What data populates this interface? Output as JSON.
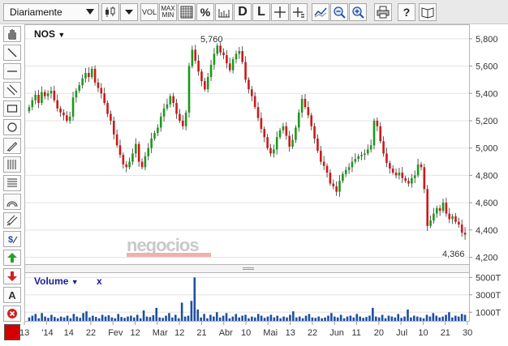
{
  "toolbar": {
    "period_label": "Diariamente",
    "vol_label": "VOL",
    "maxmin_top": "MAX",
    "maxmin_bottom": "MIN",
    "percent_label": "%",
    "daily_label": "D",
    "line_label": "L",
    "icons": [
      "candle-type-icon",
      "chart-style-icon",
      "grid-icon",
      "scale-icon",
      "crosshair-icon",
      "crosshair-value-icon",
      "compare-icon",
      "zoom-out-icon",
      "zoom-in-icon",
      "print-icon",
      "help-icon",
      "book-icon"
    ]
  },
  "tools": [
    "hand-icon",
    "line-icon",
    "horizontal-line-icon",
    "channel-icon",
    "rectangle-icon",
    "ellipse-icon",
    "pencil-icon",
    "fibonacci-fan-icon",
    "fibonacci-retracement-icon",
    "arc-icon",
    "parallel-lines-icon",
    "dollar-icon",
    "arrow-up-icon",
    "arrow-down-icon",
    "text-icon",
    "delete-icon"
  ],
  "colors": {
    "up": "#1a9a1a",
    "down": "#d01818",
    "volume": "#1f4fa0",
    "grid": "#e3e3e3",
    "swatch": "#d40000"
  },
  "price_pane": {
    "ticker": "NOS",
    "ticker_caret": "▼",
    "high_label": "5,760",
    "last_label": "4,366",
    "watermark": "negocios",
    "y_labels": [
      "5,800",
      "5,600",
      "5,400",
      "5,200",
      "5,000",
      "4,800",
      "4,600",
      "4,400",
      "4,200"
    ]
  },
  "volume_pane": {
    "title": "Volume",
    "caret": "▼",
    "close": "x",
    "y_labels": [
      "5000T",
      "3000T",
      "1000T"
    ]
  },
  "x_labels": [
    "13",
    "'14",
    "14",
    "22",
    "Fev",
    "12",
    "Mar",
    "12",
    "21",
    "Abr",
    "10",
    "Mai",
    "13",
    "22",
    "Jun",
    "11",
    "20",
    "Jul",
    "10",
    "21",
    "30"
  ],
  "chart_data": {
    "type": "candlestick",
    "ylim": [
      4150,
      5900
    ],
    "y_ticks": [
      5800,
      5600,
      5400,
      5200,
      5000,
      4800,
      4600,
      4400,
      4200
    ],
    "high": 5760,
    "last": 4366,
    "close_series": [
      5300,
      5350,
      5390,
      5330,
      5410,
      5380,
      5400,
      5420,
      5350,
      5290,
      5260,
      5240,
      5200,
      5230,
      5370,
      5420,
      5460,
      5510,
      5550,
      5520,
      5580,
      5480,
      5440,
      5400,
      5330,
      5250,
      5200,
      5100,
      5020,
      4950,
      4880,
      4860,
      4900,
      4960,
      5030,
      4900,
      4860,
      4940,
      5000,
      5070,
      5110,
      5150,
      5230,
      5290,
      5320,
      5380,
      5330,
      5250,
      5200,
      5160,
      5260,
      5600,
      5720,
      5640,
      5560,
      5490,
      5430,
      5520,
      5610,
      5690,
      5750,
      5700,
      5680,
      5620,
      5570,
      5650,
      5690,
      5710,
      5630,
      5500,
      5430,
      5380,
      5300,
      5220,
      5140,
      5080,
      5000,
      4960,
      4990,
      5080,
      5130,
      5160,
      5090,
      5010,
      5060,
      5150,
      5260,
      5360,
      5300,
      5240,
      5160,
      5070,
      4980,
      4900,
      4870,
      4820,
      4740,
      4720,
      4680,
      4760,
      4810,
      4840,
      4860,
      4900,
      4920,
      4940,
      4950,
      4960,
      4990,
      5020,
      5200,
      5160,
      5050,
      4960,
      4890,
      4850,
      4820,
      4800,
      4820,
      4780,
      4760,
      4740,
      4780,
      4800,
      4880,
      4860,
      4700,
      4430,
      4470,
      4520,
      4560,
      4540,
      4600,
      4520,
      4480,
      4500,
      4460,
      4440,
      4380,
      4366
    ],
    "volume_series_thousands": [
      400,
      600,
      800,
      300,
      900,
      500,
      350,
      700,
      450,
      300,
      500,
      400,
      600,
      300,
      800,
      500,
      350,
      900,
      1100,
      400,
      600,
      450,
      300,
      700,
      500,
      650,
      400,
      300,
      800,
      450,
      350,
      500,
      600,
      400,
      700,
      300,
      1200,
      500,
      450,
      650,
      1500,
      400,
      350,
      600,
      900,
      400,
      700,
      300,
      2100,
      500,
      600,
      2300,
      5000,
      1300,
      400,
      800,
      300,
      700,
      500,
      1000,
      400,
      600,
      900,
      300,
      500,
      800,
      400,
      600,
      700,
      300,
      500,
      400,
      800,
      600,
      350,
      500,
      700,
      400,
      600,
      300,
      500,
      400,
      700,
      1100,
      400,
      500,
      300,
      600,
      800,
      400,
      350,
      500,
      300,
      400,
      600,
      900,
      500,
      400,
      700,
      300,
      500,
      600,
      400,
      800,
      500,
      350,
      450,
      600,
      1500,
      500,
      400,
      700,
      300,
      600,
      500,
      400,
      800,
      350,
      500,
      1300,
      400,
      600,
      500,
      400,
      300,
      700,
      500,
      900,
      600,
      400,
      500,
      700,
      1000,
      400,
      600,
      500,
      800,
      700
    ]
  }
}
